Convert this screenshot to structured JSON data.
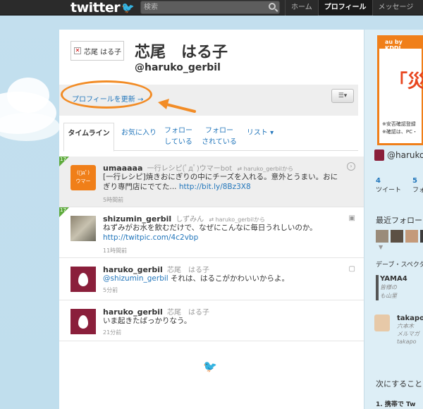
{
  "topbar": {
    "logo": "twitter",
    "search_placeholder": "検索",
    "nav": [
      "ホーム",
      "プロフィール",
      "メッセージ"
    ]
  },
  "profile": {
    "thumb_label": "芯尾 はる子",
    "name": "芯尾　はる子",
    "handle": "@haruko_gerbil",
    "edit_link": "プロフィールを更新 →"
  },
  "tabs": [
    {
      "line1": "タイムライン",
      "line2": ""
    },
    {
      "line1": "お気に入り",
      "line2": ""
    },
    {
      "line1": "フォロー",
      "line2": "している"
    },
    {
      "line1": "フォロー",
      "line2": "されている"
    },
    {
      "line1": "リスト ▾",
      "line2": ""
    }
  ],
  "tweets": [
    {
      "user": "umaaaaa",
      "fullname": "一行レシピ(ﾟдﾟ)ウマーbot",
      "rt": "haruko_gerbilから",
      "text": "[一行レシピ]焼きおにぎりの中にチーズを入れる。意外とうまい。おにぎり専門店にでてた...",
      "link": "http://bit.ly/8Bz3X8",
      "time": "5時間前",
      "avatar_top": "(ﾟдﾟ)",
      "avatar_bottom": "ウマー"
    },
    {
      "user": "shizumin_gerbil",
      "fullname": "しずみん",
      "rt": "haruko_gerbilから",
      "text": "ねずみがお水を飲むだけで、なぜにこんなに毎日うれしいのか。",
      "link": "http://twitpic.com/4c2vbp",
      "time": "11時間前"
    },
    {
      "user": "haruko_gerbil",
      "fullname": "芯尾　はる子",
      "mention": "@shizumin_gerbil",
      "text": " それは、はるこがかわいいからよ。",
      "time": "5分前"
    },
    {
      "user": "haruko_gerbil",
      "fullname": "芯尾　はる子",
      "text": "いま起きたばっかりなう。",
      "time": "21分前"
    }
  ],
  "retweet_badge": "17",
  "sidebar": {
    "ad_brand": "au by KDDI",
    "ad_headline": "「災",
    "ad_line1": "※安否確認登録",
    "ad_line2": "※確認は、PC・",
    "handle": "@haruko_",
    "count1": "4",
    "count1_label": "ツイート",
    "count2": "5",
    "count2_label": "フォ",
    "recent_follow": "最近フォロー",
    "debe": "デーブ・スペクタ",
    "yama": "YAMA4",
    "yama_sub1": "皆様の",
    "yama_sub2": "も山里",
    "taka": "takapo",
    "taka_sub1": "六本木",
    "taka_sub2": "メルマガ",
    "taka_sub3": "takapo",
    "next": "次にすること",
    "next_item": "1. 携帯で Tw"
  },
  "colors": {
    "accent": "#2276bb",
    "annotation": "#f28c26",
    "retweet": "#5eab3c"
  }
}
